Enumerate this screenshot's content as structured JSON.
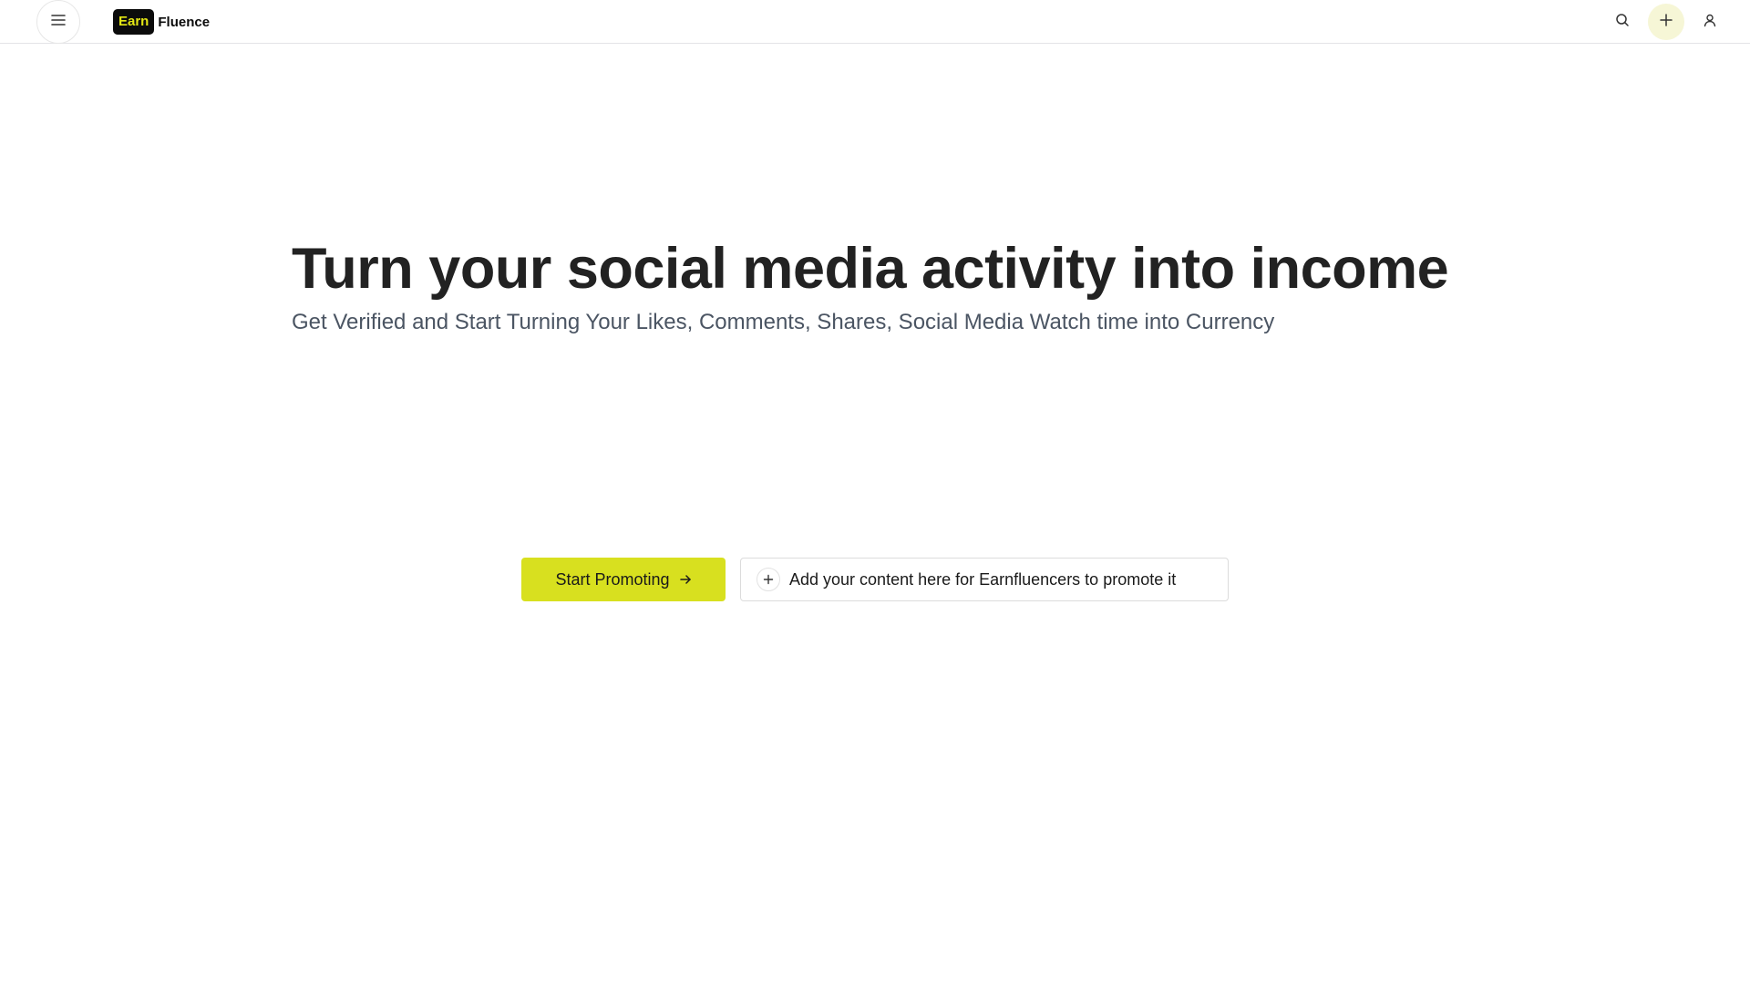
{
  "header": {
    "menu_icon": "hamburger-menu-icon",
    "logo": {
      "badge_text": "Earn",
      "text": "Fluence"
    },
    "icons": [
      "search-icon",
      "plus-icon",
      "user-icon"
    ]
  },
  "hero": {
    "title": "Turn your social media activity into income",
    "subtitle": "Get Verified and Start Turning Your Likes, Comments, Shares, Social Media Watch time into Currency"
  },
  "actions": {
    "primary_label": "Start Promoting",
    "primary_icon": "arrow-right-icon",
    "secondary_label": "Add your content here for Earnfluencers to promote it",
    "secondary_icon": "plus-icon"
  },
  "colors": {
    "accent": "#d8e01f",
    "logo_badge_bg": "#0b0b0b",
    "logo_badge_text": "#e3e614",
    "add_button_bg": "#f6f6d6"
  }
}
